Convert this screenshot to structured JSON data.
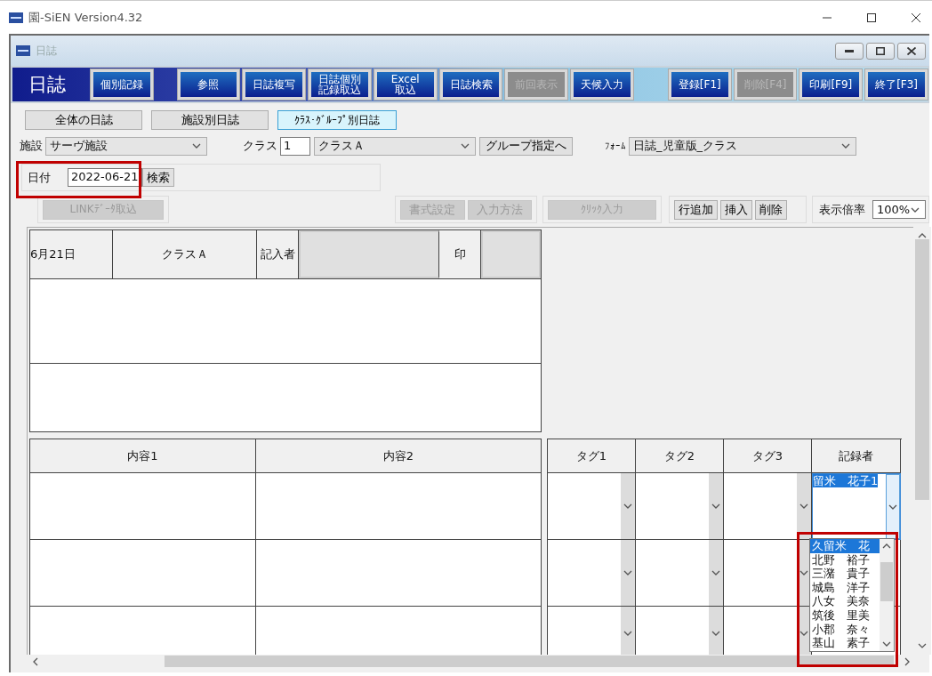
{
  "app_window": {
    "title": "園-SiEN Version4.32"
  },
  "child_window": {
    "title": "日誌"
  },
  "toolbar": {
    "heading": "日誌",
    "buttons": [
      {
        "label": "個別記録",
        "disabled": false
      },
      {
        "label": "参照",
        "disabled": false
      },
      {
        "label": "日誌複写",
        "disabled": false
      },
      {
        "label": "日誌個別記録取込",
        "disabled": false
      },
      {
        "label": "Excel\n取込",
        "disabled": false
      },
      {
        "label": "日誌検索",
        "disabled": false
      },
      {
        "label": "前回表示",
        "disabled": true
      },
      {
        "label": "天候入力",
        "disabled": false
      },
      {
        "label": "登録[F1]",
        "disabled": false
      },
      {
        "label": "削除[F4]",
        "disabled": true
      },
      {
        "label": "印刷[F9]",
        "disabled": false
      },
      {
        "label": "終了[F3]",
        "disabled": false
      }
    ]
  },
  "view_tabs": [
    {
      "label": "全体の日誌",
      "selected": false
    },
    {
      "label": "施設別日誌",
      "selected": false
    },
    {
      "label": "ｸﾗｽ･ｸﾞﾙｰﾌﾟ別日誌",
      "selected": true
    }
  ],
  "filters": {
    "facility_label": "施設",
    "facility": "サーヴ施設",
    "class_label": "クラス",
    "class_number": "1",
    "class_name": "クラスＡ",
    "group_button": "グループ指定へ",
    "form_label": "ﾌｫｰﾑ",
    "form": "日誌_児童版_クラス"
  },
  "date_search": {
    "label": "日付",
    "value": "2022-06-21",
    "button": "検索"
  },
  "tools": [
    {
      "label": "LINKﾃﾞｰﾀ取込",
      "disabled": true
    },
    {
      "label": "書式設定",
      "disabled": true
    },
    {
      "label": "入力方法",
      "disabled": true
    },
    {
      "label": "ｸﾘｯｸ入力",
      "disabled": true
    },
    {
      "label": "行追加",
      "disabled": false
    },
    {
      "label": "挿入",
      "disabled": false
    },
    {
      "label": "削除",
      "disabled": false
    }
  ],
  "zoom": {
    "label": "表示倍率",
    "value": "100%"
  },
  "sheet": {
    "date": "6月21日",
    "class_name": "クラスＡ",
    "writer_label": "記入者",
    "seal_label": "印",
    "content_columns": [
      "内容1",
      "内容2"
    ],
    "tag_columns": [
      "タグ1",
      "タグ2",
      "タグ3"
    ],
    "recorder_column": "記録者",
    "recorder_value": "留米　花子1",
    "recorder_list": [
      {
        "label": "久留米　花",
        "selected": true
      },
      {
        "label": "北野　裕子",
        "selected": false
      },
      {
        "label": "三潴　貴子",
        "selected": false
      },
      {
        "label": "城島　洋子",
        "selected": false
      },
      {
        "label": "八女　美奈",
        "selected": false
      },
      {
        "label": "筑後　里美",
        "selected": false
      },
      {
        "label": "小郡　奈々",
        "selected": false
      },
      {
        "label": "基山　素子",
        "selected": false
      }
    ]
  }
}
